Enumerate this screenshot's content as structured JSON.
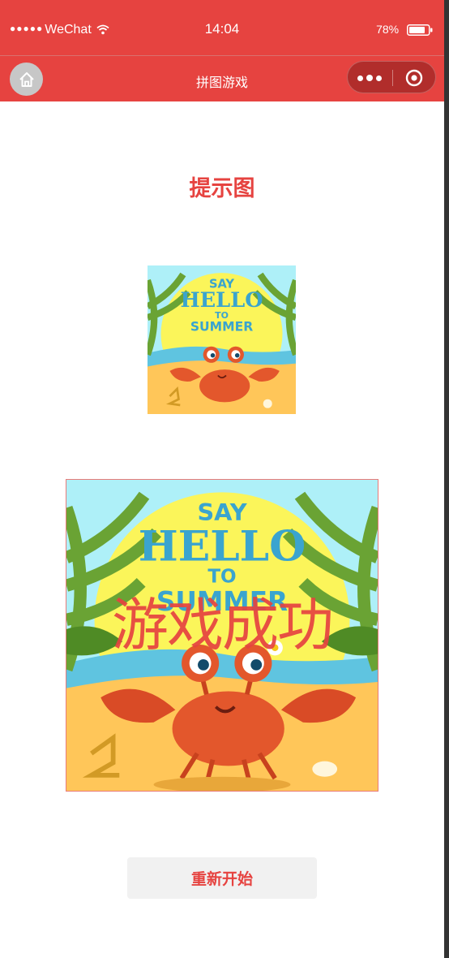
{
  "status_bar": {
    "carrier": "WeChat",
    "time": "14:04",
    "battery": "78%"
  },
  "nav": {
    "title": "拼图游戏"
  },
  "hint": {
    "title": "提示图",
    "image_text": {
      "line1": "SAY",
      "line2": "HELLO",
      "line3": "TO",
      "line4": "SUMMER"
    }
  },
  "puzzle": {
    "success_message": "游戏成功"
  },
  "actions": {
    "restart_label": "重新开始"
  },
  "colors": {
    "accent": "#e64340",
    "sky": "#aef0f8",
    "sun": "#fbf55a",
    "sand": "#ffc659",
    "crab": "#e3572c",
    "leaf": "#6aa334",
    "title_blue": "#3aa4cf"
  },
  "icons": {
    "home": "home-icon",
    "more": "more-dots-icon",
    "close": "target-close-icon",
    "wifi": "wifi-icon",
    "battery": "battery-icon"
  }
}
